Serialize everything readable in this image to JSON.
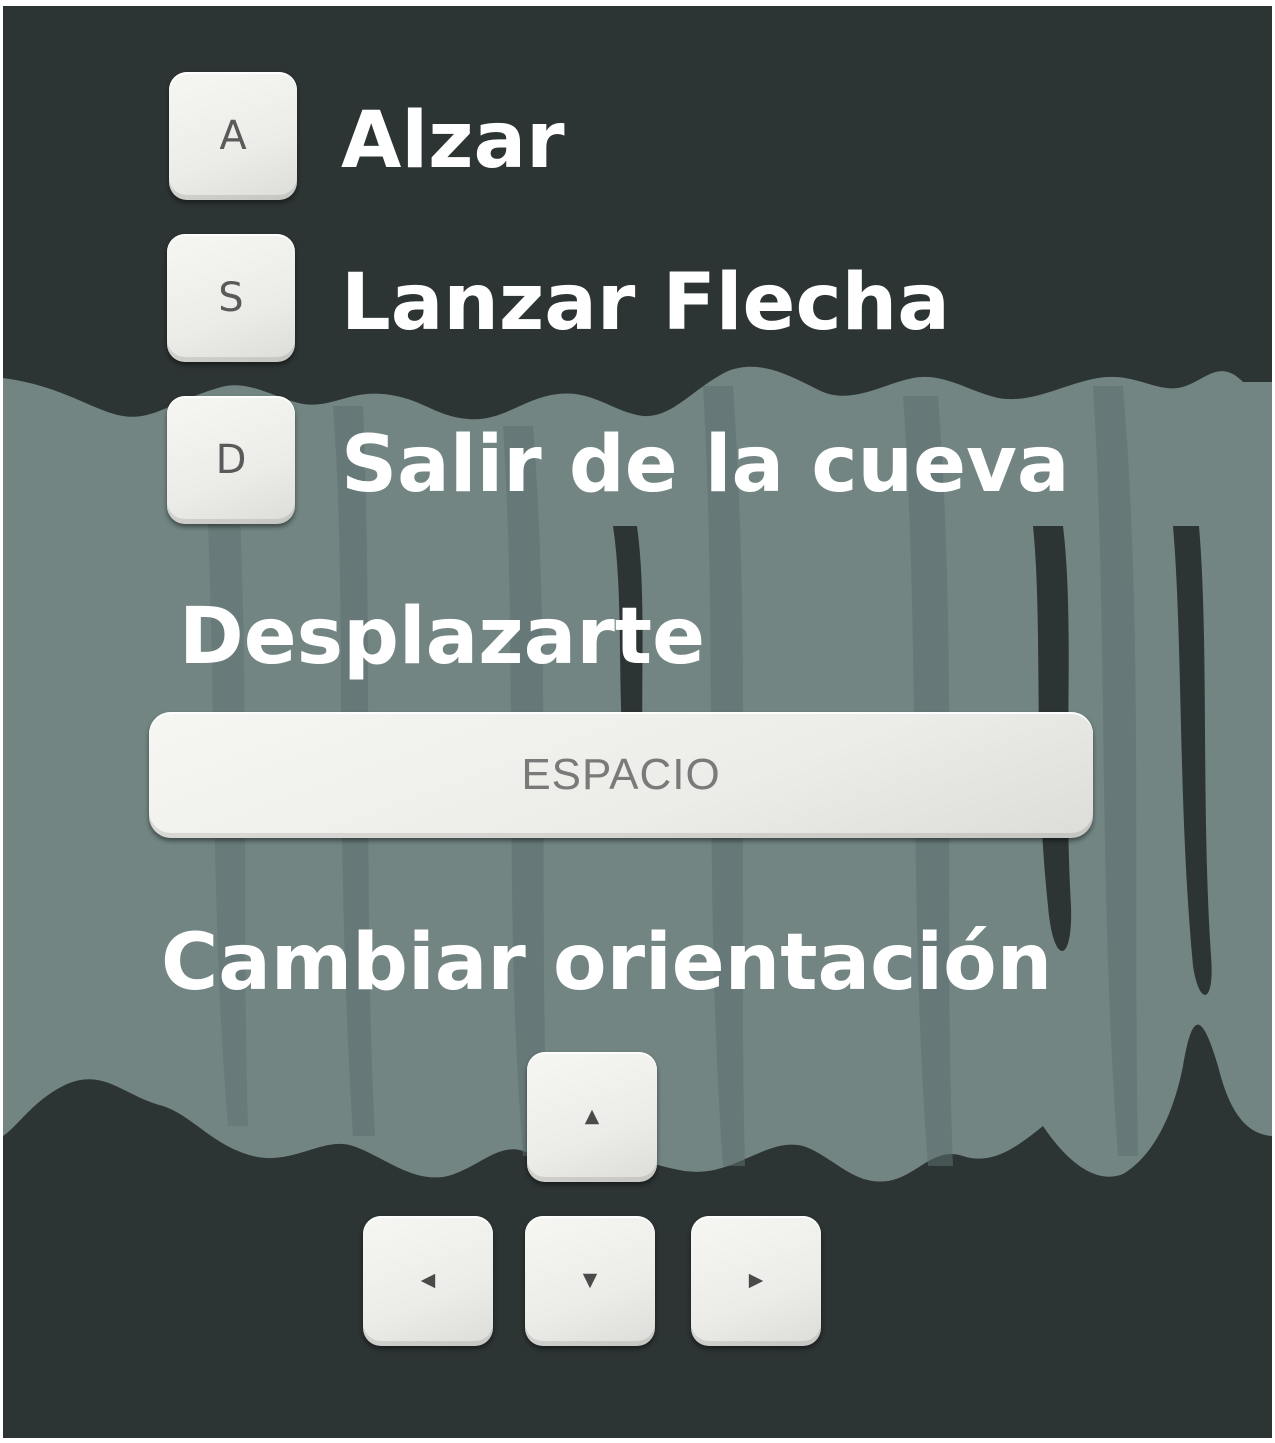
{
  "actions": [
    {
      "key": "A",
      "label": "Alzar"
    },
    {
      "key": "S",
      "label": "Lanzar Flecha"
    },
    {
      "key": "D",
      "label": "Salir de la cueva"
    }
  ],
  "move": {
    "title": "Desplazarte",
    "key_label": "ESPACIO"
  },
  "orientation": {
    "title": "Cambiar orientación",
    "keys": [
      "arrow-up",
      "arrow-left",
      "arrow-down",
      "arrow-right"
    ]
  },
  "colors": {
    "background": "#2d3434",
    "cave": "#728583",
    "cave_shadow": "#58696a",
    "text": "#ffffff",
    "key": "#ecece8"
  }
}
